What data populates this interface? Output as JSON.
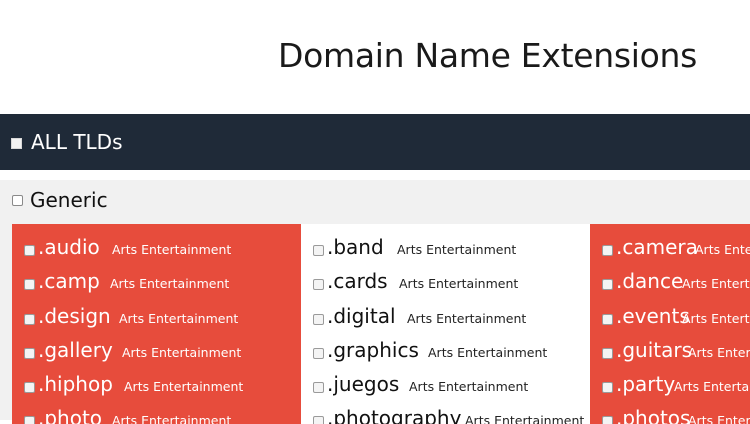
{
  "page": {
    "title": "Domain Name Extensions"
  },
  "all_tlds": {
    "label": "ALL TLDs"
  },
  "generic": {
    "label": "Generic",
    "columns": [
      {
        "color": "#e74c3c",
        "items": [
          {
            "tld": ".audio",
            "category": "Arts Entertainment"
          },
          {
            "tld": ".camp",
            "category": "Arts Entertainment"
          },
          {
            "tld": ".design",
            "category": "Arts Entertainment"
          },
          {
            "tld": ".gallery",
            "category": "Arts Entertainment"
          },
          {
            "tld": ".hiphop",
            "category": "Arts Entertainment"
          },
          {
            "tld": ".photo",
            "category": "Arts Entertainment"
          }
        ]
      },
      {
        "color": "#ffffff",
        "items": [
          {
            "tld": ".band",
            "category": "Arts Entertainment"
          },
          {
            "tld": ".cards",
            "category": "Arts Entertainment"
          },
          {
            "tld": ".digital",
            "category": "Arts Entertainment"
          },
          {
            "tld": ".graphics",
            "category": "Arts Entertainment"
          },
          {
            "tld": ".juegos",
            "category": "Arts Entertainment"
          },
          {
            "tld": ".photography",
            "category": "Arts Entertainment"
          }
        ]
      },
      {
        "color": "#e74c3c",
        "items": [
          {
            "tld": ".camera",
            "category": "Arts Entertainment"
          },
          {
            "tld": ".dance",
            "category": "Arts Entertainment"
          },
          {
            "tld": ".events",
            "category": "Arts Entertainment"
          },
          {
            "tld": ".guitars",
            "category": "Arts Entertainment"
          },
          {
            "tld": ".party",
            "category": "Arts Entertainment"
          },
          {
            "tld": ".photos",
            "category": "Arts Entertainment"
          }
        ]
      }
    ]
  }
}
